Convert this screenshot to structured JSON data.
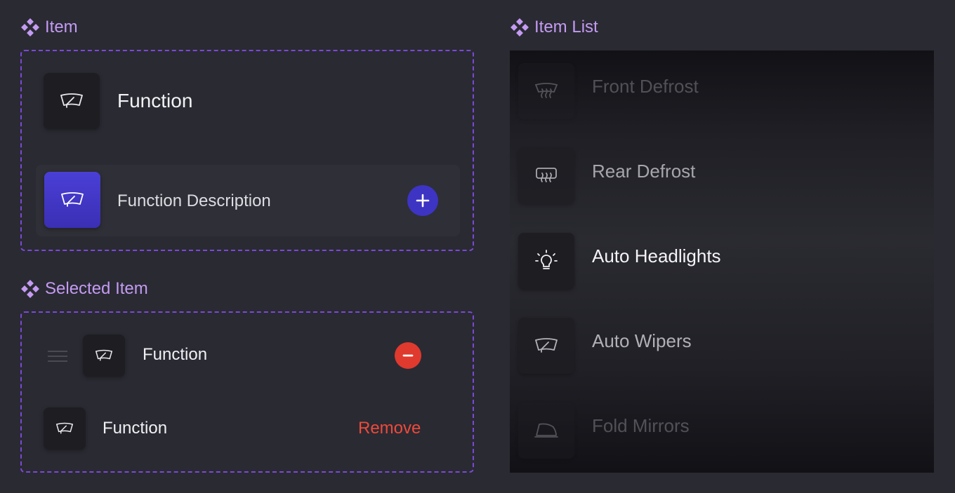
{
  "sections": {
    "item": "Item",
    "selected_item": "Selected Item",
    "item_list": "Item List"
  },
  "item_example": {
    "title": "Function",
    "description": "Function Description",
    "icon": "wiper-icon",
    "add_icon": "plus-icon"
  },
  "selected_example": {
    "row1_label": "Function",
    "row1_icon": "wiper-icon",
    "row1_action_icon": "minus-icon",
    "row2_label": "Function",
    "row2_icon": "wiper-icon",
    "row2_action": "Remove"
  },
  "item_list": [
    {
      "label": "Front Defrost",
      "icon": "front-defrost-icon"
    },
    {
      "label": "Rear Defrost",
      "icon": "rear-defrost-icon"
    },
    {
      "label": "Auto Headlights",
      "icon": "headlight-icon"
    },
    {
      "label": "Auto Wipers",
      "icon": "wiper-icon"
    },
    {
      "label": "Fold Mirrors",
      "icon": "mirror-icon"
    }
  ],
  "colors": {
    "background": "#2a2a33",
    "accent_purple": "#c49bf2",
    "dashed_border": "#7a49d6",
    "primary_blue": "#3d34c4",
    "danger_red": "#e0392e",
    "remove_text": "#ee4a3a"
  }
}
